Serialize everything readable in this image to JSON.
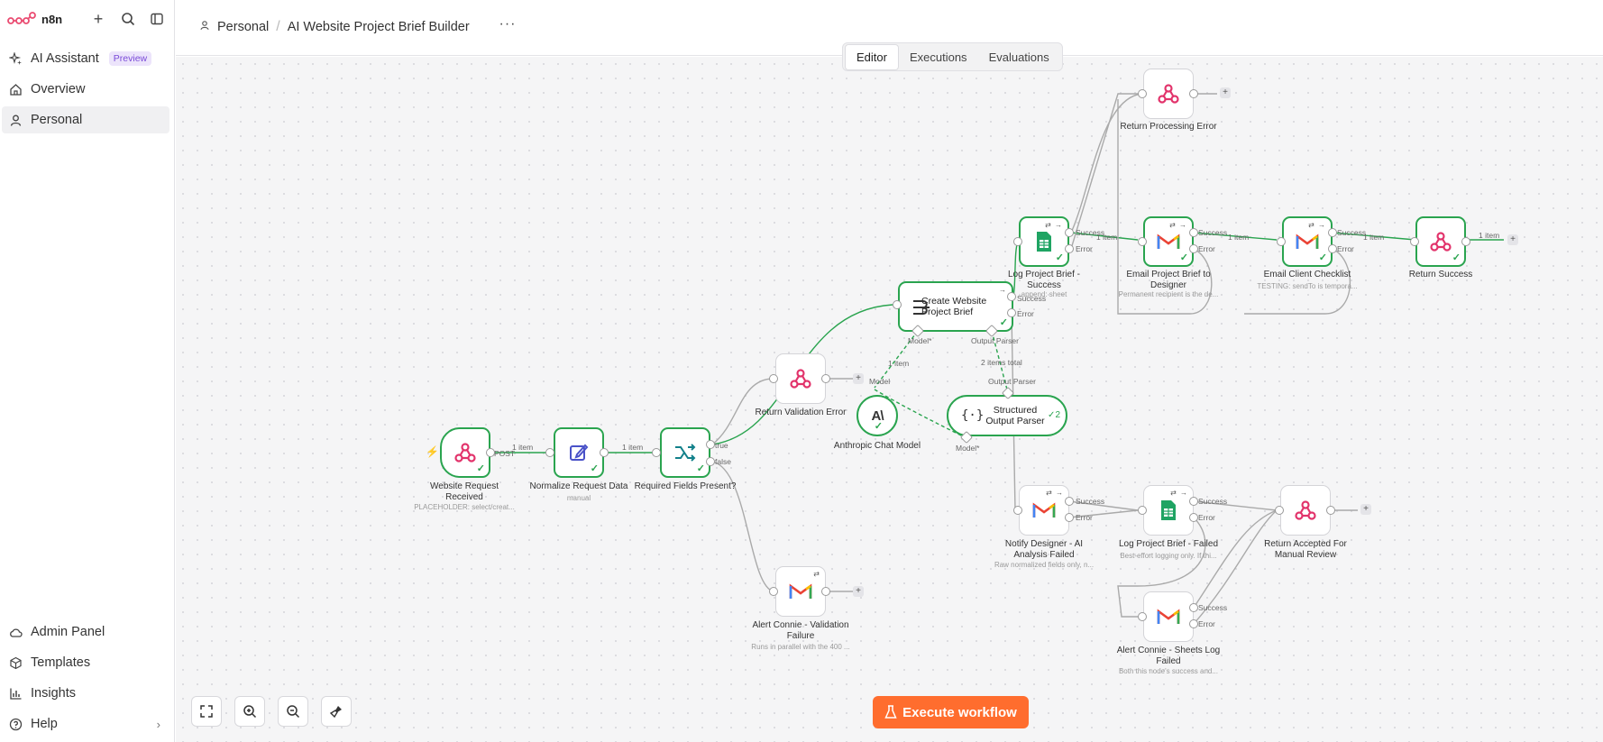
{
  "sidebar": {
    "brand": "n8n",
    "nav": [
      {
        "label": "AI Assistant",
        "badge": "Preview"
      },
      {
        "label": "Overview"
      },
      {
        "label": "Personal"
      }
    ],
    "bottom": [
      {
        "label": "Admin Panel"
      },
      {
        "label": "Templates"
      },
      {
        "label": "Insights"
      },
      {
        "label": "Help"
      }
    ]
  },
  "header": {
    "crumb_project": "Personal",
    "crumb_sep": "/",
    "title": "AI Website Project Brief Builder",
    "more": "···"
  },
  "tabs": [
    "Editor",
    "Executions",
    "Evaluations"
  ],
  "nodes": {
    "website_request": {
      "label": "Website Request Received",
      "sub": "PLACEHOLDER: select/creat..."
    },
    "normalize": {
      "label": "Normalize Request Data",
      "sub": "manual"
    },
    "required_fields": {
      "label": "Required Fields Present?"
    },
    "return_validation": {
      "label": "Return Validation Error"
    },
    "alert_validation": {
      "label": "Alert Connie - Validation Failure",
      "sub": "Runs in parallel with the 400 ..."
    },
    "create_brief": {
      "label": "Create Website Project Brief"
    },
    "anthropic": {
      "label": "Anthropic Chat Model"
    },
    "structured": {
      "label": "Structured Output Parser",
      "count": "2"
    },
    "log_success": {
      "label": "Log Project Brief - Success",
      "sub": "append: sheet"
    },
    "email_designer": {
      "label": "Email Project Brief to Designer",
      "sub": "Permanent recipient is the de..."
    },
    "email_client": {
      "label": "Email Client Checklist",
      "sub": "TESTING: sendTo is tempora..."
    },
    "return_success": {
      "label": "Return Success"
    },
    "return_processing": {
      "label": "Return Processing Error"
    },
    "notify_designer": {
      "label": "Notify Designer - AI Analysis Failed",
      "sub": "Raw normalized fields only, n..."
    },
    "log_failed": {
      "label": "Log Project Brief - Failed",
      "sub": "Best-effort logging only. If thi..."
    },
    "alert_sheets": {
      "label": "Alert Connie - Sheets Log Failed",
      "sub": "Both this node's success and..."
    },
    "return_accepted": {
      "label": "Return Accepted For Manual Review"
    }
  },
  "edge_labels": {
    "post": "POST",
    "one_item": "1 item",
    "true": "true",
    "false": "false",
    "success": "Success",
    "error": "Error",
    "model_star": "Model*",
    "model": "Model",
    "output_parser": "Output Parser",
    "two_items_total": "2 items total"
  },
  "controls": {
    "execute": "Execute workflow"
  },
  "colors": {
    "success": "#2aa44f",
    "execute": "#ff6d2e",
    "webhook": "#e2336b"
  }
}
